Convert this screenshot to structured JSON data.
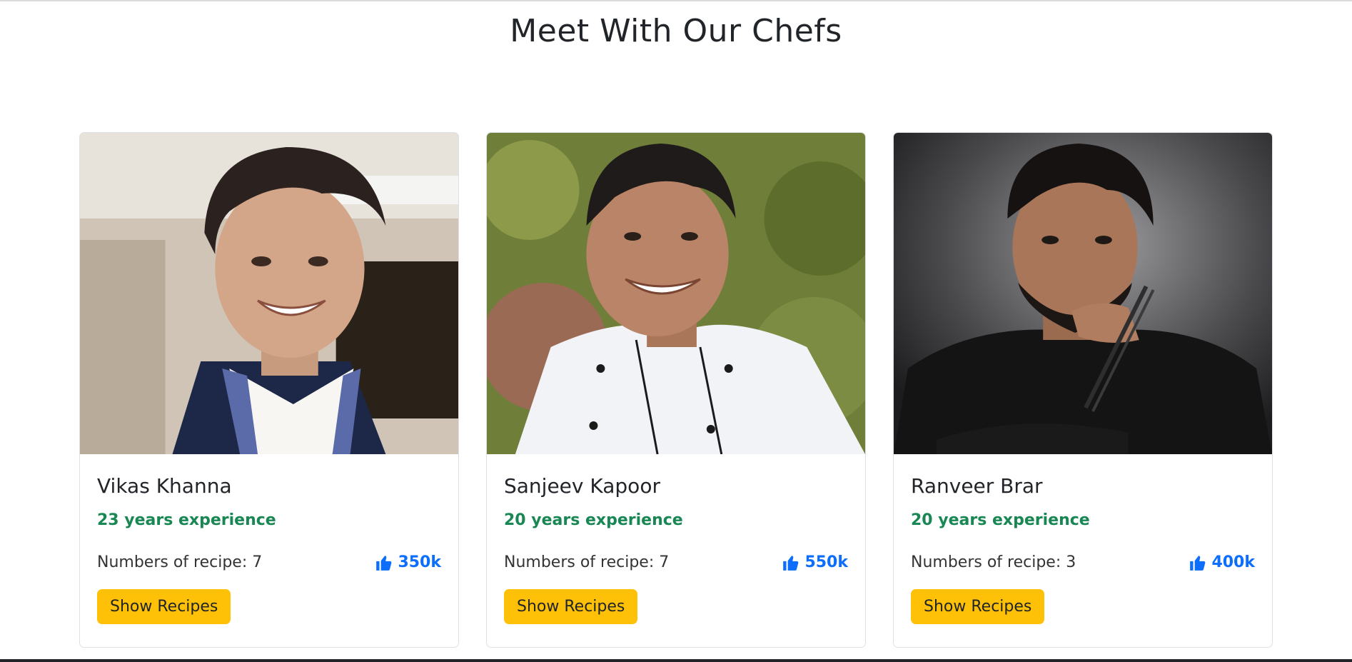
{
  "section": {
    "title": "Meet With Our Chefs"
  },
  "colors": {
    "accent_green": "#198754",
    "likes_blue": "#0d6efd",
    "button_yellow": "#ffc107"
  },
  "chefs": [
    {
      "name": "Vikas Khanna",
      "experience": "23 years experience",
      "recipes": "Numbers of recipe: 7",
      "likes": "350k",
      "likes_icon": "thumbs-up-icon",
      "button": "Show Recipes"
    },
    {
      "name": "Sanjeev Kapoor",
      "experience": "20 years experience",
      "recipes": "Numbers of recipe: 7",
      "likes": "550k",
      "likes_icon": "thumbs-up-icon",
      "button": "Show Recipes"
    },
    {
      "name": "Ranveer Brar",
      "experience": "20 years experience",
      "recipes": "Numbers of recipe: 3",
      "likes": "400k",
      "likes_icon": "thumbs-up-icon",
      "button": "Show Recipes"
    }
  ]
}
